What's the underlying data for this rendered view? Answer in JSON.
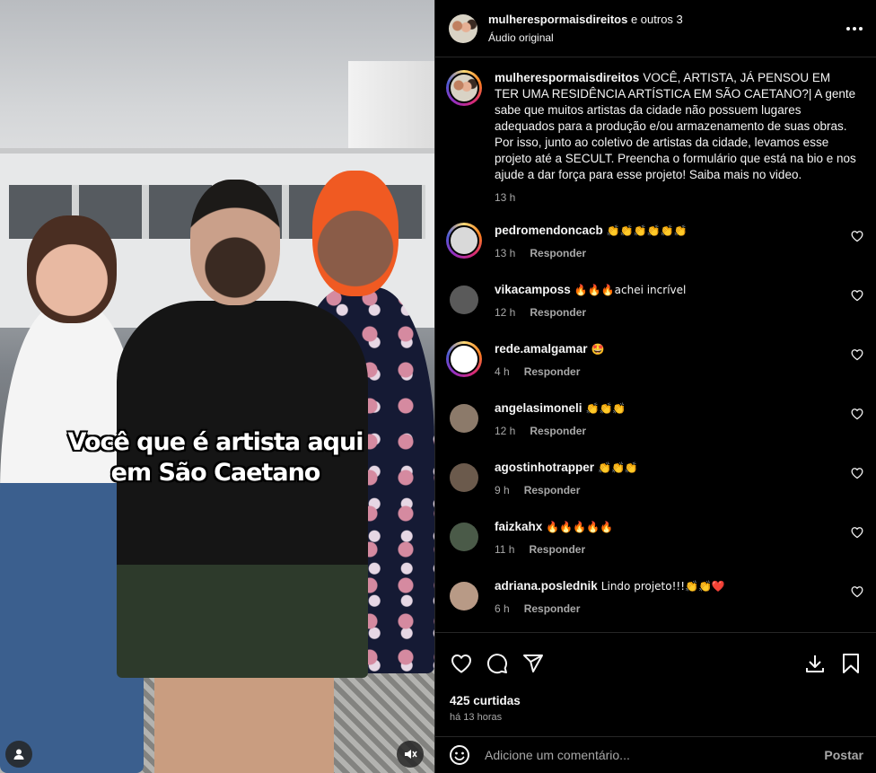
{
  "video": {
    "overlay_line1": "Você que é artista aqui",
    "overlay_line2": "em São Caetano"
  },
  "header": {
    "username": "mulherespormaisdireitos",
    "others": "e outros 3",
    "subtitle": "Áudio original"
  },
  "caption": {
    "username": "mulherespormaisdireitos",
    "text": "VOCÊ, ARTISTA, JÁ PENSOU EM TER UMA RESIDÊNCIA ARTÍSTICA EM SÃO CAETANO?| A gente sabe que muitos artistas da cidade não possuem lugares adequados para a produção e/ou armazenamento de suas obras. Por isso, junto ao coletivo de artistas da cidade, levamos esse projeto até a SECULT. Preencha o formulário que está na bio e nos ajude a dar força para esse projeto! Saiba mais no video.",
    "time": "13 h"
  },
  "reply_label": "Responder",
  "comments": [
    {
      "user": "pedromendoncacb",
      "text": "👏👏👏👏👏👏",
      "time": "13 h",
      "avatar_color": "#d9d9d9",
      "ring": true
    },
    {
      "user": "vikacamposs",
      "text": "🔥🔥🔥achei incrível",
      "time": "12 h",
      "avatar_color": "#5a5a5a",
      "ring": false
    },
    {
      "user": "rede.amalgamar",
      "text": "🤩",
      "time": "4 h",
      "avatar_color": "#ffffff",
      "ring": true
    },
    {
      "user": "angelasimoneli",
      "text": "👏👏👏",
      "time": "12 h",
      "avatar_color": "#8c7a6a",
      "ring": false
    },
    {
      "user": "agostinhotrapper",
      "text": "👏👏👏",
      "time": "9 h",
      "avatar_color": "#6b5a4c",
      "ring": false
    },
    {
      "user": "faizkahx",
      "text": "🔥🔥🔥🔥🔥",
      "time": "11 h",
      "avatar_color": "#4a5a48",
      "ring": false
    },
    {
      "user": "adriana.poslednik",
      "text": "Lindo projeto!!!👏👏❤️",
      "time": "6 h",
      "avatar_color": "#b89a86",
      "ring": false
    }
  ],
  "stats": {
    "likes": "425 curtidas",
    "posted": "há 13 horas"
  },
  "composer": {
    "placeholder": "Adicione um comentário...",
    "post_label": "Postar"
  }
}
